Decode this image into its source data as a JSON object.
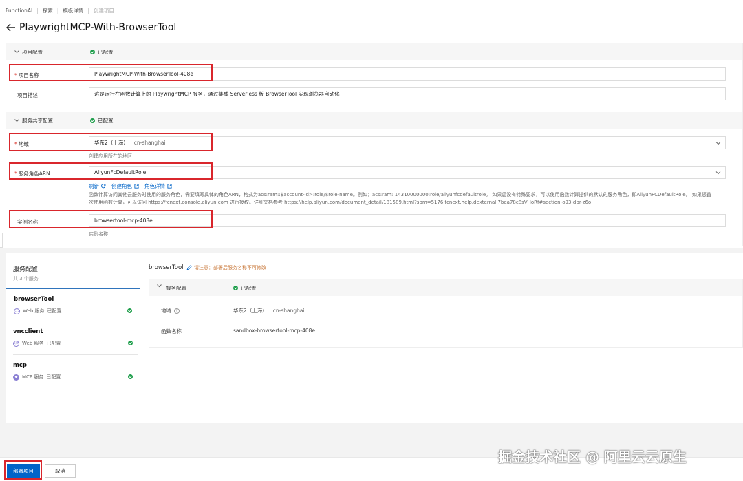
{
  "breadcrumb": [
    "FunctionAI",
    "探索",
    "模板详情",
    "创建项目"
  ],
  "page_title": "PlaywrightMCP-With-BrowserTool",
  "project_config": {
    "title": "项目配置",
    "status": "已配置",
    "name_label": "项目名称",
    "name_value": "PlaywrightMCP-With-BrowserTool-408e",
    "desc_label": "项目描述",
    "desc_value": "这是运行在函数计算上的 PlaywrightMCP 服务，通过集成 Serverless 版 BrowserTool 实现浏览器自动化"
  },
  "shared_config": {
    "title": "服务共享配置",
    "status": "已配置",
    "region_label": "地域",
    "region_value": "华东2（上海）",
    "region_code": "cn-shanghai",
    "region_hint": "创建应用所在的地区",
    "role_label": "服务角色ARN",
    "role_value": "AliyunFcDefaultRole",
    "links": [
      "刷新",
      "创建角色",
      "角色详情"
    ],
    "role_desc_line1": "函数计算访问其他云服务时使用的服务角色，需要填写具体的角色ARN，格式为acs:ram::$account-id>:role/$role-name。例如：acs:ram::14310000000:role/aliyunfcdefaultrole。 如果您没有特殊要求，可以使用函数计算提供的默认的服务角色，即AliyunFCDefaultRole。 如果您首",
    "role_desc_line2": "次使用函数计算，可以访问 https://fcnext.console.aliyun.com 进行授权。详细文档参考 https://help.aliyun.com/document_detail/181589.html?spm=5176.fcnext.help.dexternal.7bea78c8sVHoRf#section-o93-dbr-z6o",
    "instance_label": "实例名称",
    "instance_value": "browsertool-mcp-408e",
    "instance_hint": "实例名称"
  },
  "services": {
    "title": "服务配置",
    "count": "共 3 个服务",
    "items": [
      {
        "name": "browserTool",
        "type": "Web 服务",
        "status": "已配置"
      },
      {
        "name": "vncclient",
        "type": "Web 服务",
        "status": "已配置"
      },
      {
        "name": "mcp",
        "type": "MCP 服务",
        "status": "已配置"
      }
    ]
  },
  "detail": {
    "name": "browserTool",
    "warning": "请注意：部署后服务名称不可修改",
    "section_title": "服务配置",
    "status": "已配置",
    "region_label": "地域",
    "region_value": "华东2（上海）",
    "region_code": "cn-shanghai",
    "func_label": "函数名称",
    "func_value": "sandbox-browsertool-mcp-408e"
  },
  "actions": {
    "deploy": "部署项目",
    "cancel": "取消"
  },
  "watermark": "掘金技术社区 @ 阿里云云原生",
  "colors": {
    "primary": "#0064c8",
    "highlight": "#d9262c",
    "success": "#1e9e4b"
  }
}
